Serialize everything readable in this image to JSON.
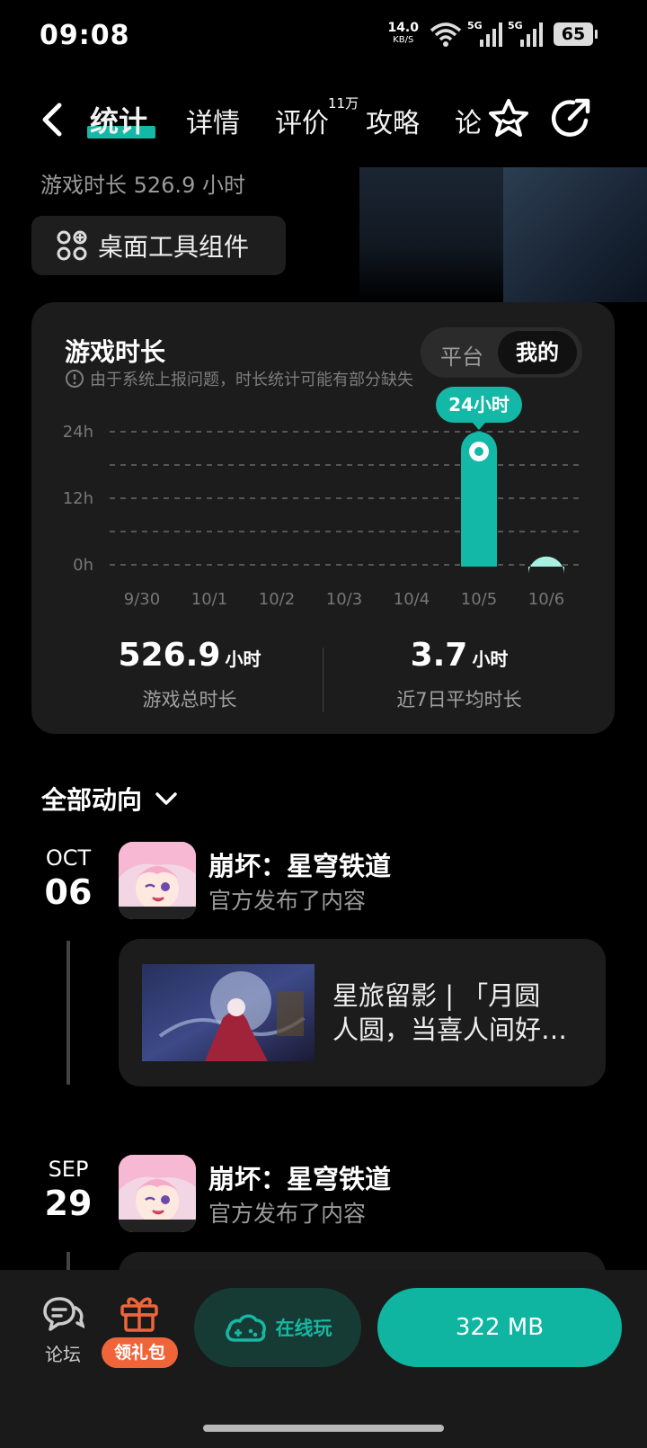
{
  "status_bar": {
    "time": "09:08",
    "net_speed": "14.0",
    "net_unit": "KB/S",
    "sig1": "5G",
    "sig2": "5G",
    "battery": "65"
  },
  "nav": {
    "tabs": [
      "统计",
      "详情",
      "评价",
      "攻略",
      "论"
    ],
    "active_tab": "统计",
    "review_count": "11万",
    "icons": [
      "back-icon",
      "star-favorite-icon",
      "share-icon"
    ],
    "accent": "#14b8a6"
  },
  "header": {
    "playtime": "游戏时长 526.9 小时",
    "widget_button": "桌面工具组件"
  },
  "stats_card": {
    "title": "游戏时长",
    "note": "由于系统上报问题，时长统计可能有部分缺失",
    "toggle": [
      "平台",
      "我的"
    ],
    "toggle_selected": "我的",
    "tooltip": "24小时",
    "total_value": "526.9",
    "total_unit": "小时",
    "total_label": "游戏总时长",
    "avg_value": "3.7",
    "avg_unit": "小时",
    "avg_label": "近7日平均时长"
  },
  "chart_data": {
    "type": "bar",
    "categories": [
      "9/30",
      "10/1",
      "10/2",
      "10/3",
      "10/4",
      "10/5",
      "10/6"
    ],
    "values": [
      0,
      0,
      0,
      0,
      0,
      24,
      1.5
    ],
    "y_ticks": [
      "0h",
      "12h",
      "24h"
    ],
    "ylim": [
      0,
      24
    ],
    "highlight_index": 5,
    "colors": {
      "bar": "#14b8a6",
      "bar_light": "#a8efe4",
      "grid": "#555555"
    }
  },
  "feed": {
    "title": "全部动向",
    "posts": [
      {
        "month": "OCT",
        "day": "06",
        "name": "崩坏：星穹铁道",
        "sub": "官方发布了内容",
        "text1": "星旅留影 | 「月圆",
        "text2": "人圆，当喜人间好…"
      },
      {
        "month": "SEP",
        "day": "29",
        "name": "崩坏：星穹铁道",
        "sub": "官方发布了内容"
      }
    ]
  },
  "bottom_bar": {
    "forum": "论坛",
    "gift": "领礼包",
    "cloud_play": "在线玩",
    "download": "322 MB"
  }
}
